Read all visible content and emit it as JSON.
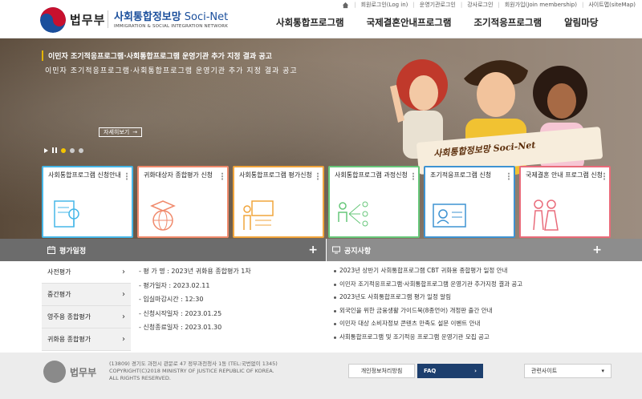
{
  "util_links": [
    "회원로그인(Log in)",
    "운영기관로그인",
    "강사로그인",
    "회원가입(Join membership)",
    "사이트맵(siteMap)"
  ],
  "header": {
    "ministry": "법무부",
    "brand_kr": "사회통합정보망",
    "brand_en": "Soci-Net",
    "brand_sub": "IMMIGRATION & SOCIAL INTEGRATION NETWORK",
    "nav": [
      "사회통합프로그램",
      "국제결혼안내프로그램",
      "조기적응프로그램",
      "알림마당"
    ]
  },
  "hero": {
    "title": "이민자 조기적응프로그램·사회통합프로그램 운영기관 추가 지정 결과 공고",
    "subtitle": "이민자 조기적응프로그램·사회통합프로그램 운영기관 추가 지정 결과 공고",
    "more_label": "자세히보기",
    "banner_text": "사회통합정보망 Soci-Net",
    "slide_count": 3,
    "active_slide": 1
  },
  "cards": [
    {
      "label": "사회통합프로그램 신청안내",
      "icon": "book-search-icon"
    },
    {
      "label": "귀화대상자 종합평가 신청",
      "icon": "graduation-globe-icon"
    },
    {
      "label": "사회통합프로그램 평가신청",
      "icon": "presentation-icon"
    },
    {
      "label": "사회통합프로그램 과정신청",
      "icon": "people-checklist-icon"
    },
    {
      "label": "조기적응프로그램 신청",
      "icon": "id-card-icon"
    },
    {
      "label": "국제결혼 안내 프로그램 신청",
      "icon": "couple-icon"
    }
  ],
  "eval": {
    "title": "평가일정",
    "tabs": [
      "사전평가",
      "중간평가",
      "영주용 종합평가",
      "귀화용 종합평가"
    ],
    "active_tab": 0,
    "details": [
      "- 평 가 명 : 2023년 귀화용 종합평가 1차",
      "- 평가일자 : 2023.02.11",
      "- 입실마감시간 : 12:30",
      "- 신청시작일자 : 2023.01.25",
      "- 신청종료일자 : 2023.01.30"
    ]
  },
  "notices": {
    "title": "공지사항",
    "items": [
      "2023년 상반기 사회통합프로그램 CBT 귀화용 종합평가 일정 안내",
      "이민자 조기적응프로그램·사회통합프로그램 운영기관 추가지정 결과 공고",
      "2023년도 사회통합프로그램 평가 일정 알림",
      "외국인을 위한 금융생활 가이드북(8종언어) 개정판 출간 안내",
      "이민자 대상 소비자정보 콘텐츠 만족도 설문 이벤트 안내",
      "사회통합프로그램 및 조기적응 프로그램 운영기관 모집 공고"
    ]
  },
  "footer": {
    "ministry": "법무부",
    "address": "(13809) 경기도 과천시 관문로 47 정부과천청사 1동 (TEL:국번없이 1345)",
    "copyright": "COPYRIGHT(C)2018 MINISTRY OF JUSTICE REPUBLIC OF KOREA.",
    "rights": "ALL RIGHTS RESERVED.",
    "privacy_label": "개인정보처리방침",
    "faq_label": "FAQ",
    "related_label": "관련사이트"
  },
  "colors": {
    "brand_blue": "#1b4f9c",
    "faq_navy": "#1d3f6e",
    "slide_active": "#f4c400"
  }
}
